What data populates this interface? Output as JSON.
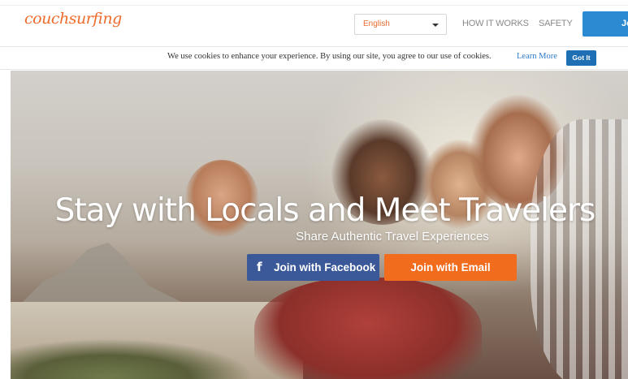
{
  "header": {
    "logo_text": "couchsurfing",
    "language_selected": "English",
    "nav": {
      "how_it_works": "HOW IT WORKS",
      "safety": "SAFETY"
    },
    "join_label": "Join"
  },
  "cookie_banner": {
    "message": "We use cookies to enhance your experience. By using our site, you agree to our use of cookies.",
    "learn_more": "Learn More",
    "got_it": "Got It"
  },
  "hero": {
    "title": "Stay with Locals and Meet Travelers",
    "subtitle": "Share Authentic Travel Experiences",
    "facebook_icon_glyph": "f",
    "join_facebook": "Join with Facebook",
    "join_email": "Join with Email"
  },
  "colors": {
    "brand_orange": "#ed6b2b",
    "join_blue": "#2c8ad2",
    "facebook_blue": "#3b5998",
    "email_orange": "#f26c1d"
  },
  "icons": {
    "dropdown": "chevron-down-icon",
    "facebook": "facebook-icon"
  }
}
